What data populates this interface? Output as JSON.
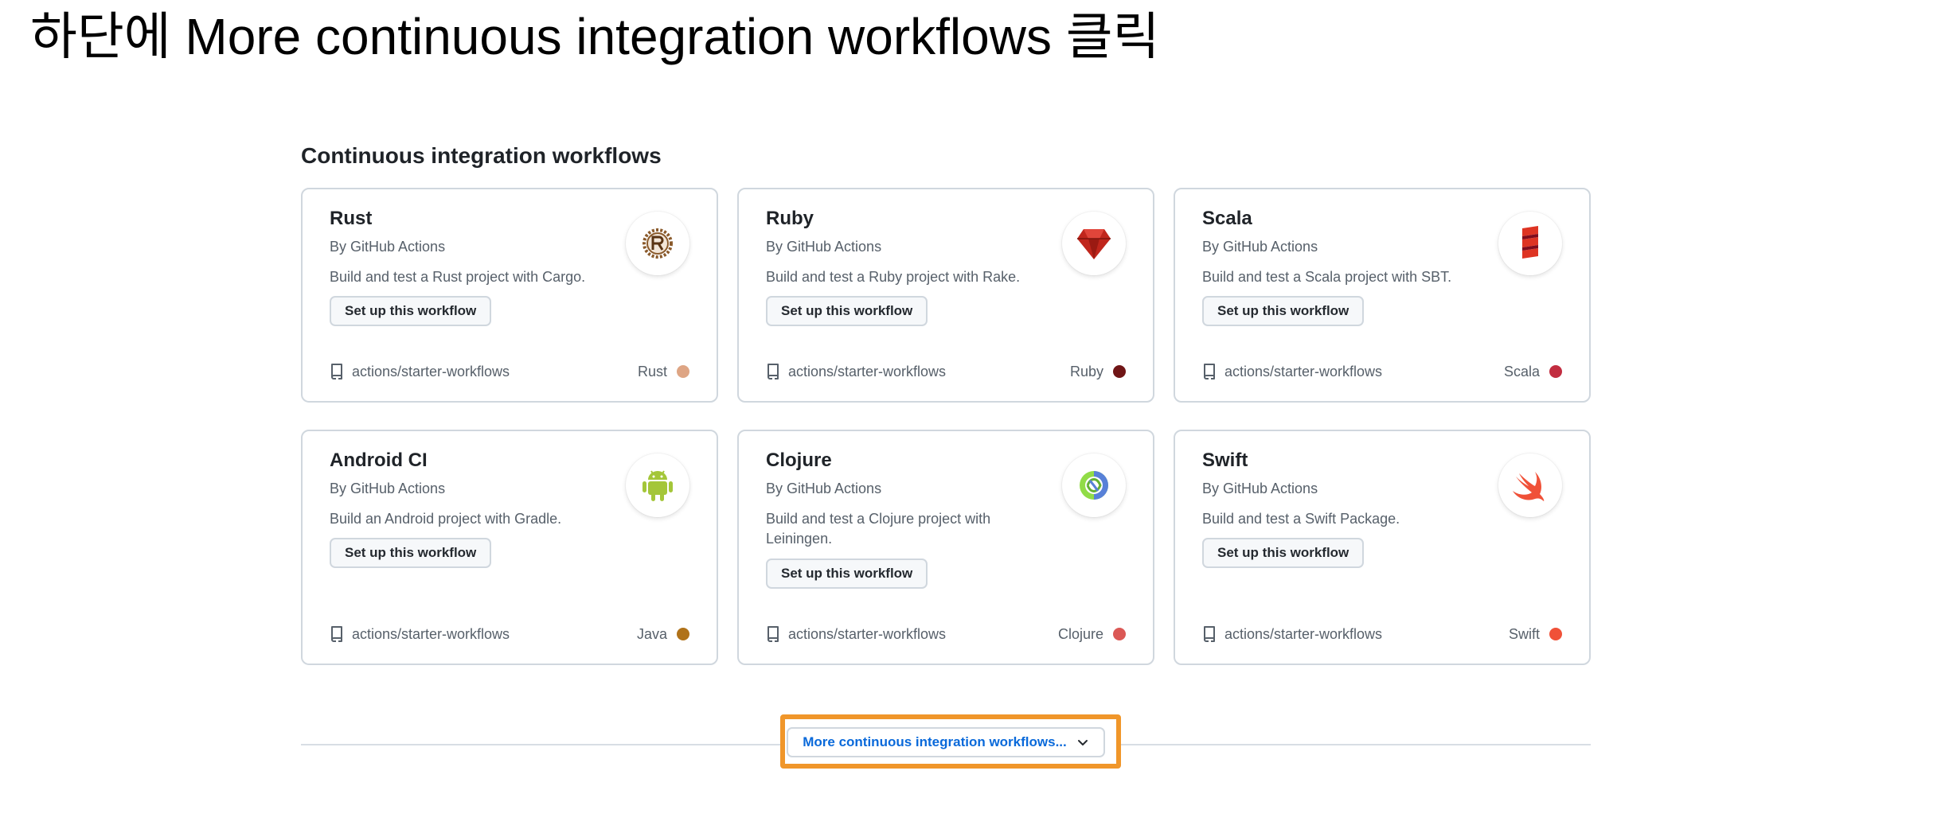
{
  "instruction": "하단에 More continuous integration workflows 클릭",
  "section_title": "Continuous integration workflows",
  "cards": [
    {
      "name": "Rust",
      "author": "By GitHub Actions",
      "description": "Build and test a Rust project with Cargo.",
      "setup_label": "Set up this workflow",
      "repo": "actions/starter-workflows",
      "language": "Rust",
      "language_color": "#dea584",
      "icon": "rust-logo-icon"
    },
    {
      "name": "Ruby",
      "author": "By GitHub Actions",
      "description": "Build and test a Ruby project with Rake.",
      "setup_label": "Set up this workflow",
      "repo": "actions/starter-workflows",
      "language": "Ruby",
      "language_color": "#701516",
      "icon": "ruby-logo-icon"
    },
    {
      "name": "Scala",
      "author": "By GitHub Actions",
      "description": "Build and test a Scala project with SBT.",
      "setup_label": "Set up this workflow",
      "repo": "actions/starter-workflows",
      "language": "Scala",
      "language_color": "#c22d40",
      "icon": "scala-logo-icon"
    },
    {
      "name": "Android CI",
      "author": "By GitHub Actions",
      "description": "Build an Android project with Gradle.",
      "setup_label": "Set up this workflow",
      "repo": "actions/starter-workflows",
      "language": "Java",
      "language_color": "#b07219",
      "icon": "android-logo-icon"
    },
    {
      "name": "Clojure",
      "author": "By GitHub Actions",
      "description": "Build and test a Clojure project with Leiningen.",
      "setup_label": "Set up this workflow",
      "repo": "actions/starter-workflows",
      "language": "Clojure",
      "language_color": "#db5855",
      "icon": "clojure-logo-icon"
    },
    {
      "name": "Swift",
      "author": "By GitHub Actions",
      "description": "Build and test a Swift Package.",
      "setup_label": "Set up this workflow",
      "repo": "actions/starter-workflows",
      "language": "Swift",
      "language_color": "#f05138",
      "icon": "swift-logo-icon"
    }
  ],
  "more_button": {
    "label": "More continuous integration workflows...",
    "icon": "chevron-down-icon"
  },
  "colors": {
    "highlight": "#f0962a",
    "link": "#0969da"
  }
}
